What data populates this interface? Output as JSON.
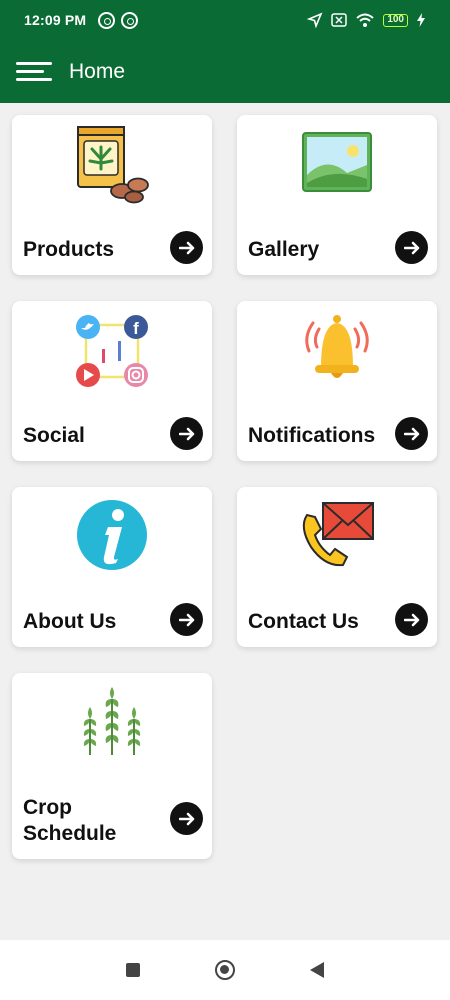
{
  "status_bar": {
    "time": "12:09 PM",
    "battery": "100"
  },
  "app_bar": {
    "title": "Home",
    "menu_icon": "hamburger-menu-icon"
  },
  "cards": [
    {
      "label": "Products",
      "icon": "seed-bag-icon"
    },
    {
      "label": "Gallery",
      "icon": "landscape-image-icon"
    },
    {
      "label": "Social",
      "icon": "social-media-icon"
    },
    {
      "label": "Notifications",
      "icon": "bell-icon"
    },
    {
      "label": "About Us",
      "icon": "info-icon"
    },
    {
      "label": "Contact Us",
      "icon": "phone-mail-icon"
    },
    {
      "label": "Crop\nSchedule",
      "icon": "wheat-icon"
    }
  ],
  "colors": {
    "primary": "#0b6b34",
    "card_arrow": "#111111"
  }
}
